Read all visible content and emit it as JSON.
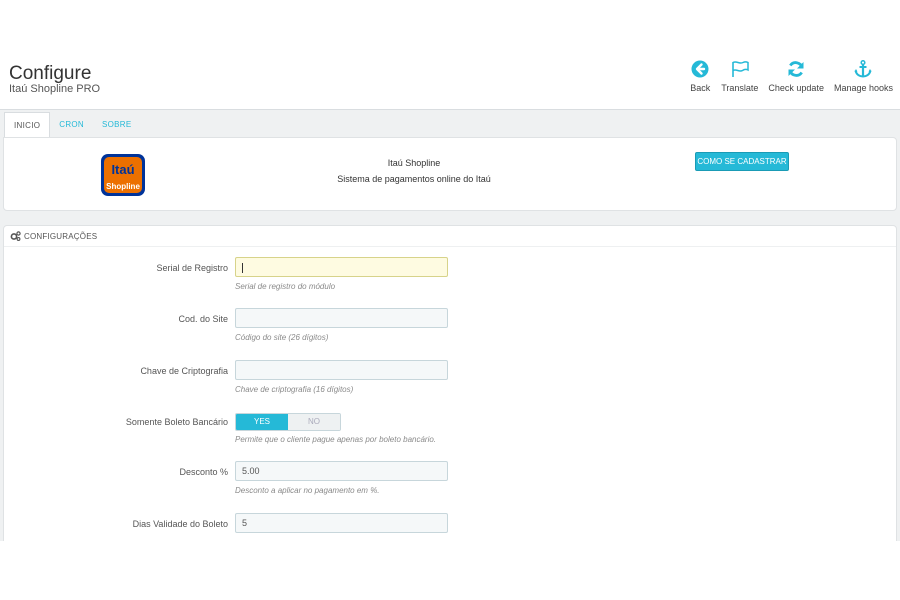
{
  "header": {
    "title": "Configure",
    "subtitle": "Itaú Shopline PRO"
  },
  "toolbar": {
    "back": "Back",
    "translate": "Translate",
    "check_update": "Check update",
    "manage_hooks": "Manage hooks"
  },
  "tabs": [
    "INICIO",
    "CRON",
    "SOBRE"
  ],
  "active_tab": "INICIO",
  "intro": {
    "logo_text_1": "Itaú",
    "logo_text_2": "Shopline",
    "title": "Itaú Shopline",
    "subtitle": "Sistema de pagamentos online do Itaú",
    "signup_button": "COMO SE CADASTRAR"
  },
  "config": {
    "heading": "CONFIGURAÇÕES",
    "fields": [
      {
        "label": "Serial de Registro",
        "value": "",
        "help": "Serial de registro do módulo"
      },
      {
        "label": "Cod. do Site",
        "value": "",
        "help": "Código do site (26 dígitos)"
      },
      {
        "label": "Chave de Criptografia",
        "value": "",
        "help": "Chave de criptografia (16 dígitos)"
      },
      {
        "label": "Somente Boleto Bancário",
        "yes": "YES",
        "no": "NO",
        "selected": "YES",
        "help": "Permite que o cliente pague apenas por boleto bancário."
      },
      {
        "label": "Desconto %",
        "value": "5.00",
        "help": "Desconto a aplicar no pagamento em %."
      },
      {
        "label": "Dias Validade do Boleto",
        "value": "5"
      }
    ]
  },
  "colors": {
    "accent": "#25b9d7",
    "logo_orange": "#ec7000",
    "logo_blue": "#003399"
  }
}
